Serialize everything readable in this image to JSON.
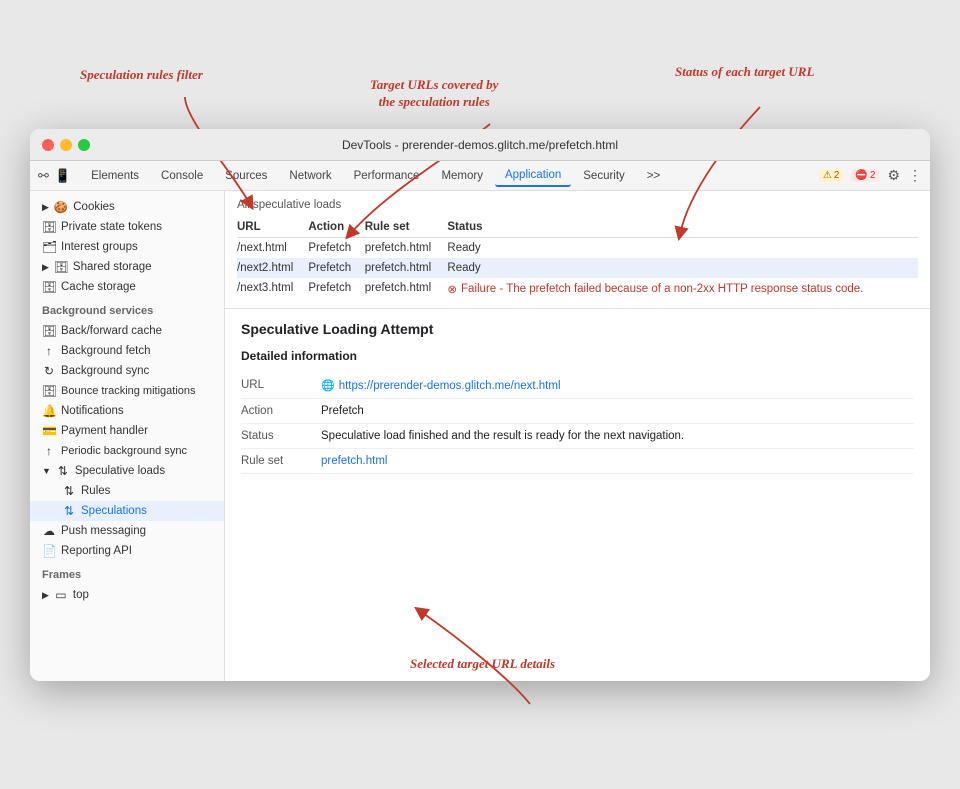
{
  "annotations": {
    "ann1": {
      "text": "Speculation rules filter",
      "class": "ann1"
    },
    "ann2": {
      "text": "Target URLs covered by\nthe speculation rules",
      "class": "ann2"
    },
    "ann3": {
      "text": "Status of each target URL",
      "class": "ann3"
    },
    "ann4": {
      "text": "Selected target URL details",
      "class": "ann4"
    }
  },
  "window": {
    "title": "DevTools - prerender-demos.glitch.me/prefetch.html"
  },
  "toolbar": {
    "icons": [
      "☰",
      "↔"
    ],
    "tabs": [
      {
        "label": "Elements",
        "active": false
      },
      {
        "label": "Console",
        "active": false
      },
      {
        "label": "Sources",
        "active": false
      },
      {
        "label": "Network",
        "active": false
      },
      {
        "label": "Performance",
        "active": false
      },
      {
        "label": "Memory",
        "active": false
      },
      {
        "label": "Application",
        "active": true
      },
      {
        "label": "Security",
        "active": false
      },
      {
        "label": ">>",
        "active": false
      }
    ],
    "badges": {
      "warn_count": "2",
      "err_count": "2"
    },
    "settings_icon": "⚙",
    "more_icon": "⋮"
  },
  "sidebar": {
    "cookies_section": {
      "items": [
        {
          "label": "Cookies",
          "icon": "🍪",
          "indent": 0,
          "expandable": true
        },
        {
          "label": "Private state tokens",
          "icon": "🗄",
          "indent": 0
        },
        {
          "label": "Interest groups",
          "icon": "🗂",
          "indent": 0
        },
        {
          "label": "Shared storage",
          "icon": "🗄",
          "indent": 0,
          "expandable": true
        },
        {
          "label": "Cache storage",
          "icon": "🗄",
          "indent": 0
        }
      ]
    },
    "background_services": {
      "label": "Background services",
      "items": [
        {
          "label": "Back/forward cache",
          "icon": "🗄",
          "indent": 0
        },
        {
          "label": "Background fetch",
          "icon": "↑",
          "indent": 0
        },
        {
          "label": "Background sync",
          "icon": "↻",
          "indent": 0
        },
        {
          "label": "Bounce tracking mitigations",
          "icon": "🗄",
          "indent": 0
        },
        {
          "label": "Notifications",
          "icon": "🔔",
          "indent": 0
        },
        {
          "label": "Payment handler",
          "icon": "💳",
          "indent": 0
        },
        {
          "label": "Periodic background sync",
          "icon": "↑",
          "indent": 0
        },
        {
          "label": "Speculative loads",
          "icon": "↑↓",
          "indent": 0,
          "expandable": true,
          "expanded": true
        },
        {
          "label": "Rules",
          "icon": "↑↓",
          "indent": 1
        },
        {
          "label": "Speculations",
          "icon": "↑↓",
          "indent": 1,
          "active": true
        },
        {
          "label": "Push messaging",
          "icon": "☁",
          "indent": 0
        },
        {
          "label": "Reporting API",
          "icon": "📄",
          "indent": 0
        }
      ]
    },
    "frames": {
      "label": "Frames",
      "items": [
        {
          "label": "top",
          "icon": "▭",
          "indent": 0,
          "expandable": true
        }
      ]
    }
  },
  "content": {
    "section_label": "All speculative loads",
    "table": {
      "headers": [
        "URL",
        "Action",
        "Rule set",
        "Status"
      ],
      "rows": [
        {
          "url": "/next.html",
          "action": "Prefetch",
          "ruleset": "prefetch.html",
          "status": "Ready",
          "status_type": "ready",
          "selected": false
        },
        {
          "url": "/next2.html",
          "action": "Prefetch",
          "ruleset": "prefetch.html",
          "status": "Ready",
          "status_type": "ready",
          "selected": true
        },
        {
          "url": "/next3.html",
          "action": "Prefetch",
          "ruleset": "prefetch.html",
          "status": "Failure - The prefetch failed because of a non-2xx HTTP response status code.",
          "status_type": "error",
          "selected": false
        }
      ]
    },
    "detail": {
      "title": "Speculative Loading Attempt",
      "subtitle": "Detailed information",
      "rows": [
        {
          "label": "URL",
          "value": "https://prerender-demos.glitch.me/next.html",
          "type": "link"
        },
        {
          "label": "Action",
          "value": "Prefetch",
          "type": "text"
        },
        {
          "label": "Status",
          "value": "Speculative load finished and the result is ready for the next navigation.",
          "type": "text"
        },
        {
          "label": "Rule set",
          "value": "prefetch.html",
          "type": "link"
        }
      ]
    }
  }
}
